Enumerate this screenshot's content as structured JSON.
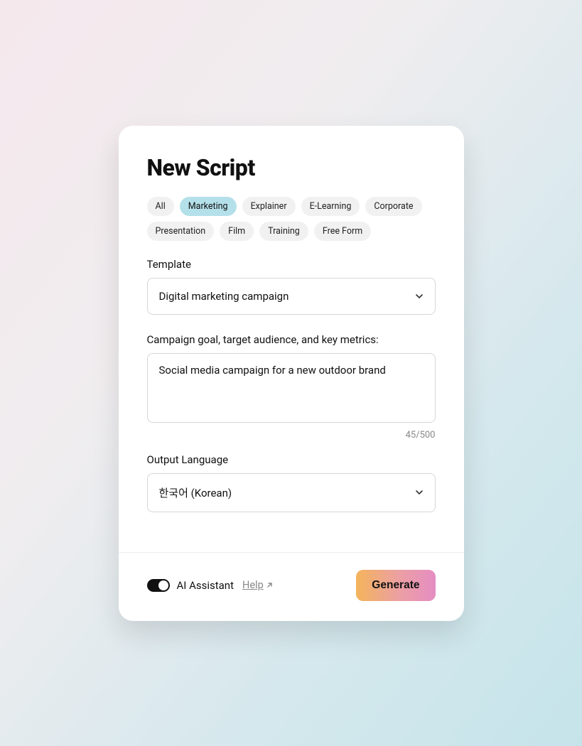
{
  "title": "New Script",
  "categories": [
    {
      "label": "All",
      "active": false
    },
    {
      "label": "Marketing",
      "active": true
    },
    {
      "label": "Explainer",
      "active": false
    },
    {
      "label": "E-Learning",
      "active": false
    },
    {
      "label": "Corporate",
      "active": false
    },
    {
      "label": "Presentation",
      "active": false
    },
    {
      "label": "Film",
      "active": false
    },
    {
      "label": "Training",
      "active": false
    },
    {
      "label": "Free Form",
      "active": false
    }
  ],
  "template": {
    "label": "Template",
    "selected": "Digital marketing campaign"
  },
  "prompt": {
    "label": "Campaign goal, target audience, and key metrics:",
    "value": "Social media campaign for a new outdoor brand",
    "counter": "45/500"
  },
  "output_language": {
    "label": "Output Language",
    "selected": "한국어 (Korean)"
  },
  "footer": {
    "ai_toggle_on": true,
    "ai_label": "AI Assistant",
    "help_label": "Help",
    "generate_label": "Generate"
  }
}
